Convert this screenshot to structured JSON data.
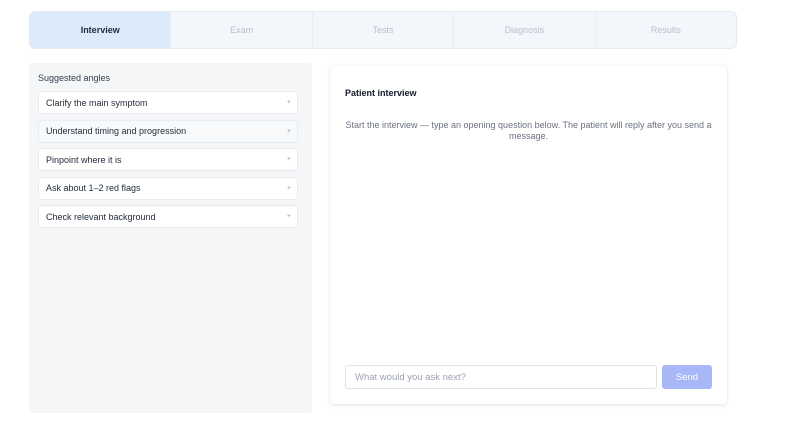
{
  "tabs": [
    {
      "label": "Interview",
      "active": true
    },
    {
      "label": "Exam",
      "active": false
    },
    {
      "label": "Tests",
      "active": false
    },
    {
      "label": "Diagnosis",
      "active": false
    },
    {
      "label": "Results",
      "active": false
    }
  ],
  "suggestions": {
    "title": "Suggested angles",
    "items": [
      {
        "label": "Clarify the main symptom",
        "action": "+"
      },
      {
        "label": "Understand timing and progression",
        "action": "+"
      },
      {
        "label": "Pinpoint where it is",
        "action": "+"
      },
      {
        "label": "Ask about 1–2 red flags",
        "action": "+"
      },
      {
        "label": "Check relevant background",
        "action": "+"
      }
    ]
  },
  "chat": {
    "title": "Patient interview",
    "empty_message": "Start the interview — type an opening question below. The patient will reply after you send a message.",
    "input_placeholder": "What would you ask next?",
    "input_value": "",
    "send_label": "Send"
  },
  "colors": {
    "active_tab": "#dcebfb",
    "send_button": "#a8b7f8"
  }
}
